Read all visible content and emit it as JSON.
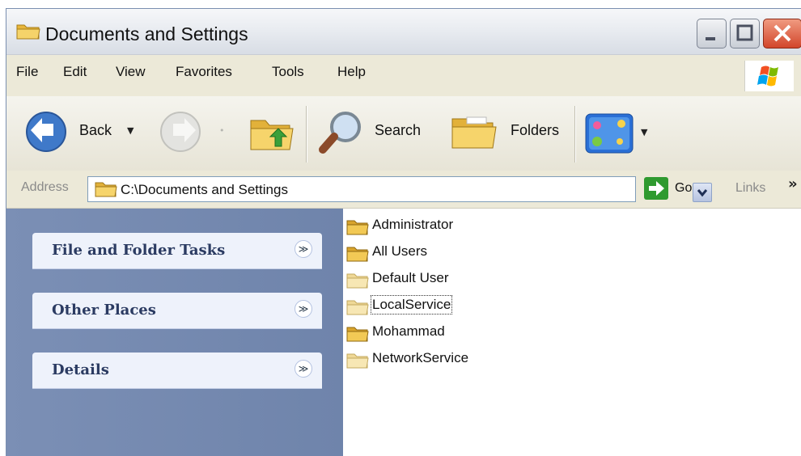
{
  "window": {
    "title": "Documents and Settings",
    "title_icon": "folder-icon",
    "controls": [
      "minimize-icon",
      "maximize-icon",
      "close-icon"
    ]
  },
  "menu": {
    "items": [
      "File",
      "Edit",
      "View",
      "Favorites",
      "Tools",
      "Help"
    ]
  },
  "toolbar": {
    "back_label": "Back",
    "search_label": "Search",
    "folders_label": "Folders",
    "icons": [
      "back-arrow-icon",
      "forward-arrow-icon",
      "folder-up-icon",
      "search-icon",
      "folders-icon",
      "views-icon"
    ]
  },
  "address": {
    "label": "Address",
    "path": "C:\\Documents and Settings",
    "go_label": "Go",
    "links_label": "Links"
  },
  "tasks": {
    "panels": [
      "File and Folder Tasks",
      "Other Places",
      "Details"
    ]
  },
  "files": {
    "items": [
      "Administrator",
      "All Users",
      "Default User",
      "LocalService",
      "Mohammad",
      "NetworkService"
    ],
    "selected": "LocalService"
  },
  "colors": {
    "left_pane_bg": "#6f84ab",
    "panel_bg": "#eef2fb",
    "panel_title": "#2b3b62",
    "close_button": "#d2462b"
  }
}
